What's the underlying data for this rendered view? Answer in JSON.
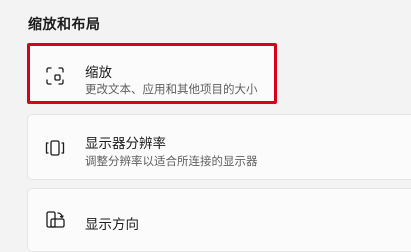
{
  "section": {
    "title": "缩放和布局"
  },
  "items": [
    {
      "title": "缩放",
      "description": "更改文本、应用和其他项目的大小",
      "icon": "scale-icon"
    },
    {
      "title": "显示器分辨率",
      "description": "调整分辨率以适合所连接的显示器",
      "icon": "resolution-icon"
    },
    {
      "title": "显示方向",
      "icon": "orientation-icon"
    }
  ],
  "colors": {
    "highlight": "#d9001b",
    "background": "#f3f3f3",
    "card": "#fbfbfb"
  }
}
